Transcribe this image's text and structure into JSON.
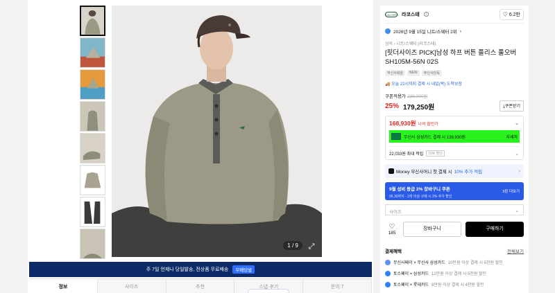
{
  "gallery": {
    "counter": "1 / 9",
    "thumb_count": 8
  },
  "banner": {
    "text": "주 7일 언제나 당일발송, 전상품 무료배송",
    "tag": "무배당발"
  },
  "tabs": [
    "정보",
    "사이즈",
    "추천",
    "스냅·후기",
    "문의"
  ],
  "tab_counts": {
    "inquiry": "7"
  },
  "store": {
    "name": "라코스테",
    "logo_text": "LACOSTE",
    "likes": "6.2만"
  },
  "rank": "2026년 9월 15일 니트/스웨터 2위",
  "breadcrumb": "상의 › 니트/스웨터 (라코스테)",
  "product": {
    "title": "[핏더사이즈 PICK]남성 하프 버튼 플리스 풀오버 SH105M-56N 02S",
    "tags": [
      "무신사회원",
      "NEW",
      "무신사단독"
    ],
    "delivery": "오늘 22시까지 결제 시 내일(목) 도착보장"
  },
  "price": {
    "label": "쿠폰적용가",
    "original": "239,000원",
    "discount": "25%",
    "current": "179,250원",
    "coupon_button": "쿠폰받기",
    "best": "168,930원",
    "best_label": "나의 할인가",
    "card_text": "무신사 삼성카드 결제 시 138,930원",
    "card_more": "자세히",
    "points": "22,033원 최대 적립",
    "points_badge": "10% 할인"
  },
  "money": {
    "text": "Money 무신사머니 첫 결제 시",
    "highlight": "10% 추가 적립"
  },
  "promo": {
    "line1": "9월 성비 등급 2% 장바구니 쿠폰",
    "line2": "06.30까지 · 2개 이상 구매 시 2% 추가 할인",
    "more": "3장 더보기"
  },
  "size_select": "사이즈",
  "actions": {
    "likes": "185",
    "cart": "장바구니",
    "buy": "구매하기"
  },
  "payment": {
    "heading": "결제혜택",
    "all": "전체보기",
    "rows": [
      {
        "name": "무신사페이 × 무신사 삼성카드",
        "desc": "10만원 이상 결제 시 5천원 할인"
      },
      {
        "name": "토스페이 × 삼성카드",
        "desc": "12만원 이상 결제 시 5천원 할인"
      },
      {
        "name": "토스페이 × 롯데카드",
        "desc": "8만원 이상 결제 시 4천원 할인"
      }
    ]
  },
  "colors": {
    "accent_red": "#e5261f",
    "banner_navy": "#0b2a66",
    "promo_blue": "#2a5be8",
    "card_green": "#28f31c"
  }
}
